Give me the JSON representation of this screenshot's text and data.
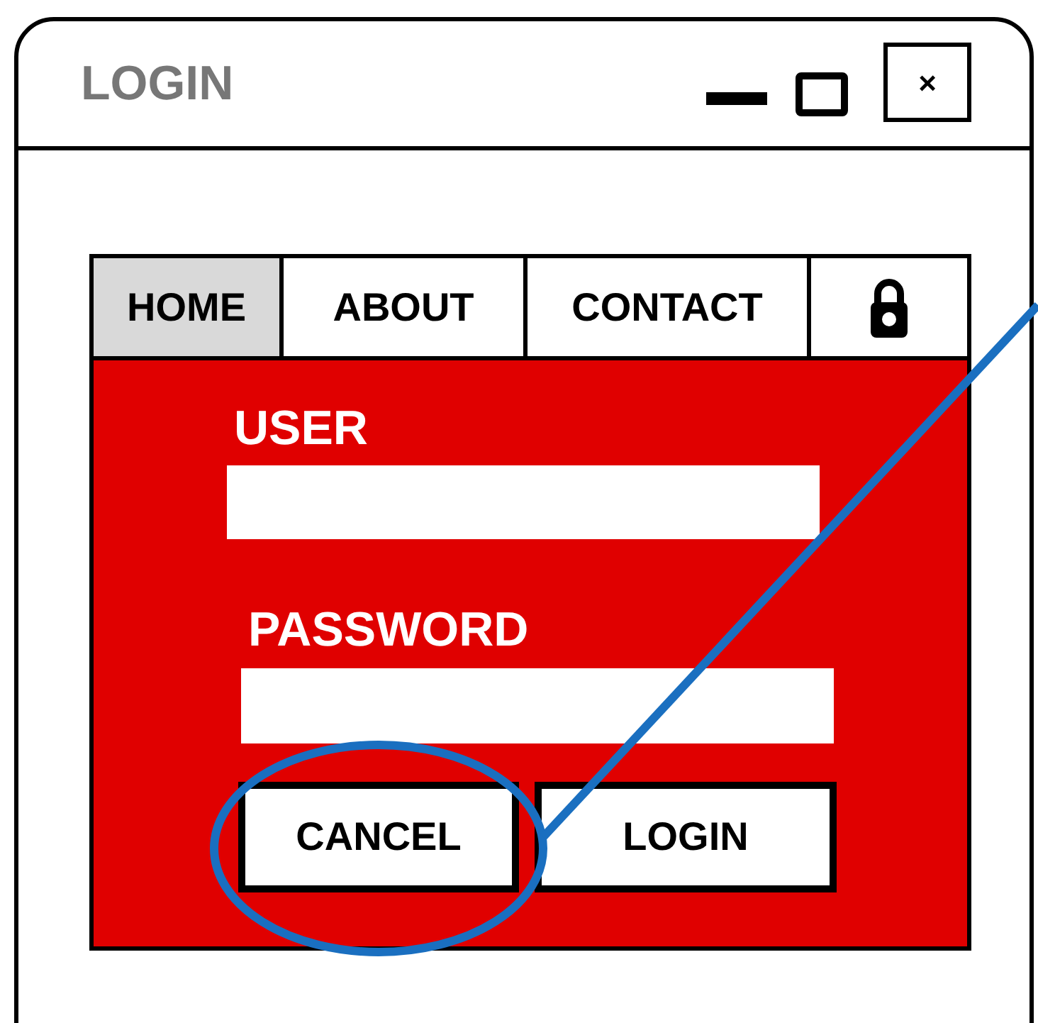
{
  "window": {
    "title": "LOGIN",
    "close_glyph": "×"
  },
  "tabs": [
    {
      "label": "HOME",
      "selected": true
    },
    {
      "label": "ABOUT",
      "selected": false
    },
    {
      "label": "CONTACT",
      "selected": false
    }
  ],
  "form": {
    "user_label": "USER",
    "password_label": "PASSWORD"
  },
  "buttons": [
    "CANCEL",
    "LOGIN"
  ]
}
